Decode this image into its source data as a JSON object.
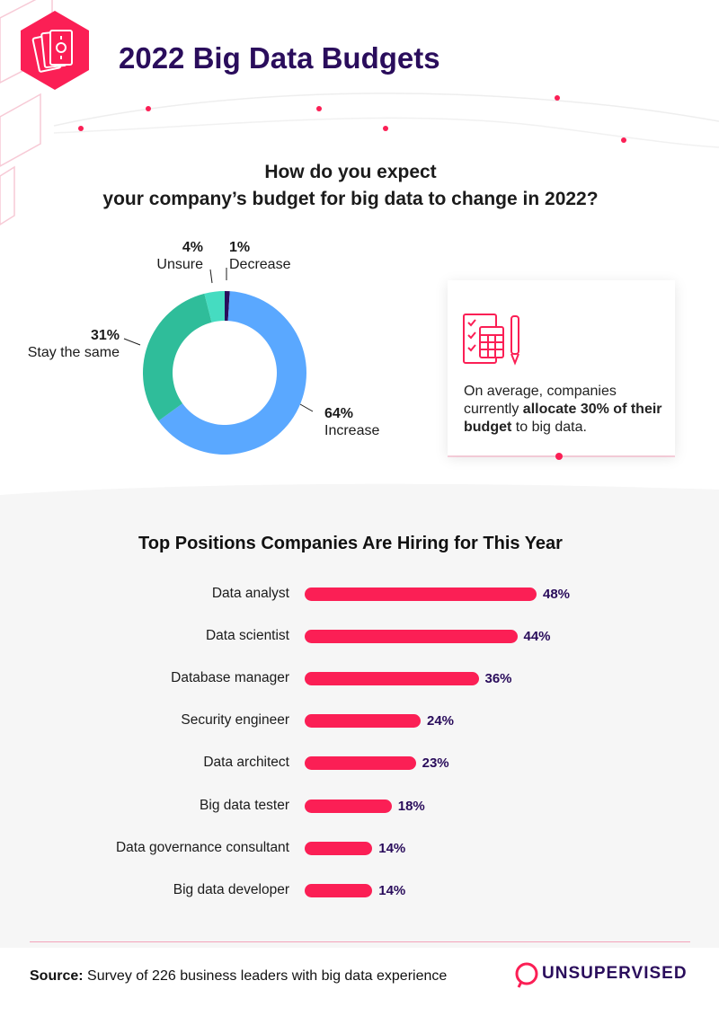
{
  "header": {
    "title": "2022 Big Data Budgets",
    "icon": "money-bills-icon"
  },
  "colors": {
    "accent": "#fb1f55",
    "title": "#2a0d5c",
    "increase": "#5aa8ff",
    "stay_same": "#2fbd9a",
    "unsure": "#45dcc1",
    "decrease": "#2a0d5c",
    "gray_panel": "#f6f6f6"
  },
  "budget_section": {
    "question_line1": "How do you expect",
    "question_line2": "your company’s budget for big data to change in 2022?",
    "slices": [
      {
        "pct": "1%",
        "label": "Decrease"
      },
      {
        "pct": "64%",
        "label": "Increase"
      },
      {
        "pct": "31%",
        "label": "Stay the same"
      },
      {
        "pct": "4%",
        "label": "Unsure"
      }
    ]
  },
  "callout": {
    "icon": "checklist-calculator-pencil-icon",
    "text_pre": "On average, companies currently ",
    "text_bold": "allocate 30% of their budget",
    "text_post": " to big data."
  },
  "hiring_section": {
    "title": "Top Positions Companies Are Hiring for This Year",
    "value_labels": [
      "48%",
      "44%",
      "36%",
      "24%",
      "23%",
      "18%",
      "14%",
      "14%"
    ]
  },
  "footer": {
    "source_label": "Source:",
    "source_text": " Survey of 226 business leaders with big data experience",
    "brand": "UNSUPERVISED",
    "brand_icon": "unsupervised-logo-icon"
  },
  "chart_data": [
    {
      "type": "pie",
      "title": "How do you expect your company’s budget for big data to change in 2022?",
      "categories": [
        "Decrease",
        "Increase",
        "Stay the same",
        "Unsure"
      ],
      "values": [
        1,
        64,
        31,
        4
      ],
      "unit": "%"
    },
    {
      "type": "bar",
      "orientation": "horizontal",
      "title": "Top Positions Companies Are Hiring for This Year",
      "categories": [
        "Data analyst",
        "Data scientist",
        "Database manager",
        "Security engineer",
        "Data architect",
        "Big data tester",
        "Data governance consultant",
        "Big data developer"
      ],
      "values": [
        48,
        44,
        36,
        24,
        23,
        18,
        14,
        14
      ],
      "unit": "%"
    }
  ]
}
